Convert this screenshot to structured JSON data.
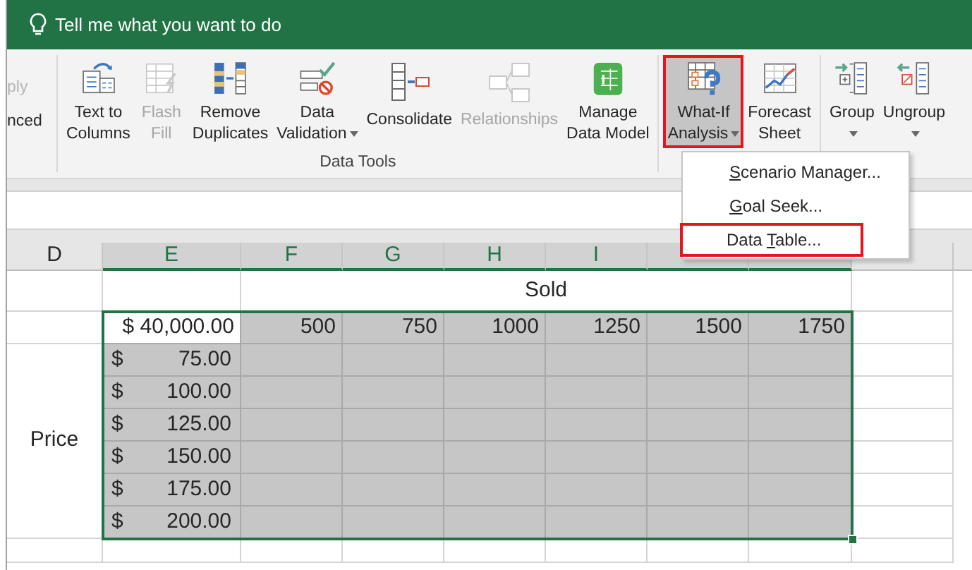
{
  "search": {
    "text": "Tell me what you want to do"
  },
  "ribbon": {
    "partial_left": [
      {
        "text": "ply",
        "disabled": true
      },
      {
        "text": "nced",
        "disabled": false
      }
    ],
    "sections": [
      {
        "label": "Data Tools",
        "buttons": [
          {
            "kind": "text-to-columns",
            "lines": [
              "Text to",
              "Columns"
            ],
            "disabled": false,
            "dropdown": false,
            "highlighted": false
          },
          {
            "kind": "flash-fill",
            "lines": [
              "Flash",
              "Fill"
            ],
            "disabled": true,
            "dropdown": false,
            "highlighted": false
          },
          {
            "kind": "remove-duplicates",
            "lines": [
              "Remove",
              "Duplicates"
            ],
            "disabled": false,
            "dropdown": false,
            "highlighted": false
          },
          {
            "kind": "data-validation",
            "lines": [
              "Data",
              "Validation"
            ],
            "disabled": false,
            "dropdown": true,
            "highlighted": false
          },
          {
            "kind": "consolidate",
            "lines": [
              "Consolidate"
            ],
            "disabled": false,
            "dropdown": false,
            "highlighted": false
          },
          {
            "kind": "relationships",
            "lines": [
              "Relationships"
            ],
            "disabled": true,
            "dropdown": false,
            "highlighted": false
          },
          {
            "kind": "data-model",
            "lines": [
              "Manage",
              "Data Model"
            ],
            "disabled": false,
            "dropdown": false,
            "highlighted": false
          }
        ]
      },
      {
        "buttons": [
          {
            "kind": "what-if",
            "lines": [
              "What-If",
              "Analysis"
            ],
            "disabled": false,
            "dropdown": true,
            "highlighted": true
          },
          {
            "kind": "forecast",
            "lines": [
              "Forecast",
              "Sheet"
            ],
            "disabled": false,
            "dropdown": false,
            "highlighted": false
          }
        ]
      },
      {
        "buttons": [
          {
            "kind": "group",
            "lines": [
              "Group"
            ],
            "disabled": false,
            "dropdown": true,
            "highlighted": false
          },
          {
            "kind": "ungroup",
            "lines": [
              "Ungroup"
            ],
            "disabled": false,
            "dropdown": true,
            "highlighted": false
          }
        ]
      }
    ]
  },
  "menu": {
    "items": [
      {
        "access_key": "S",
        "rest": "cenario Manager...",
        "highlighted": false
      },
      {
        "access_key": "G",
        "rest": "oal Seek...",
        "highlighted": false
      },
      {
        "before": "Data ",
        "access_key": "T",
        "rest": "able...",
        "highlighted": true
      }
    ]
  },
  "sheet": {
    "columns": [
      {
        "label": "D",
        "selected": false
      },
      {
        "label": "E",
        "selected": true
      },
      {
        "label": "F",
        "selected": true
      },
      {
        "label": "G",
        "selected": true
      },
      {
        "label": "H",
        "selected": true
      },
      {
        "label": "I",
        "selected": true
      },
      {
        "selected": true
      },
      {
        "selected": true
      },
      {
        "selected": false
      }
    ],
    "title_row": {
      "text": "Sold",
      "selected": false
    },
    "header_row": {
      "corner": {
        "text": "$ 40,000.00",
        "active": true
      },
      "values": [
        "500",
        "750",
        "1000",
        "1250",
        "1500",
        "1750"
      ],
      "selected": true
    },
    "side_label": "Price",
    "rows": [
      {
        "currency": "$",
        "amount": "75.00",
        "selected": true
      },
      {
        "currency": "$",
        "amount": "100.00",
        "selected": true
      },
      {
        "currency": "$",
        "amount": "125.00",
        "selected": true
      },
      {
        "currency": "$",
        "amount": "150.00",
        "selected": true
      },
      {
        "currency": "$",
        "amount": "175.00",
        "selected": true
      },
      {
        "currency": "$",
        "amount": "200.00",
        "selected": true
      }
    ]
  }
}
